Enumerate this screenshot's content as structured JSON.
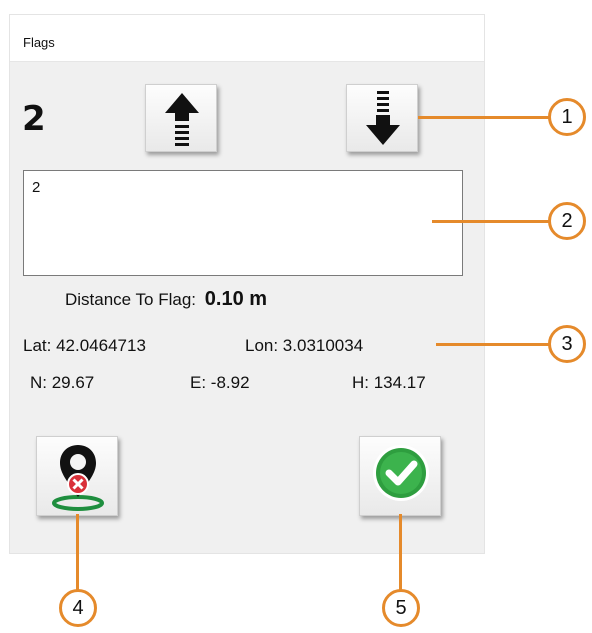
{
  "window": {
    "title": "Flags"
  },
  "flag": {
    "number": "2",
    "name_value": "2"
  },
  "distance": {
    "label": "Distance To Flag:",
    "value": "0.10 m"
  },
  "coordinates": {
    "lat": "Lat: 42.0464713",
    "lon": "Lon: 3.0310034",
    "n": "N: 29.67",
    "e": "E: -8.92",
    "h": "H: 134.17"
  },
  "icons": {
    "prev": "arrow-up-icon",
    "next": "arrow-down-icon",
    "delete": "delete-flag-icon",
    "confirm": "check-circle-icon"
  },
  "colors": {
    "callout": "#e58a2b",
    "confirm_green": "#2e9e3f",
    "delete_red": "#d9313a"
  },
  "callouts": [
    "1",
    "2",
    "3",
    "4",
    "5"
  ]
}
